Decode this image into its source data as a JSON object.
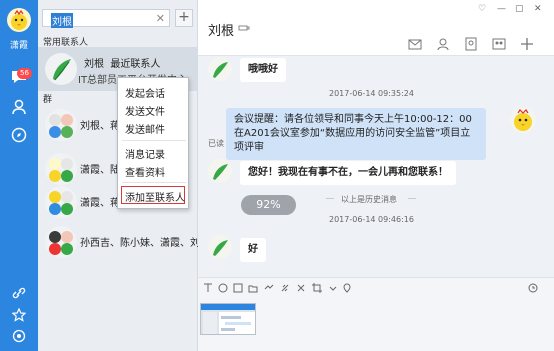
{
  "user": {
    "name": "潇霞",
    "unread": "56"
  },
  "search": {
    "value": "刘根"
  },
  "list": {
    "section_frequent": "常用联系人",
    "section_groups": "群",
    "frequent": [
      {
        "name": "刘根",
        "status": "最近联系人",
        "dept": "IT总部员工平台开发中心"
      }
    ],
    "groups": [
      {
        "members": "刘根、蒋伯"
      },
      {
        "members": "潇霞、陆涛"
      },
      {
        "members": "潇霞、蒋可"
      },
      {
        "members": "孙西吉、陈小妹、潇霞、刘根"
      }
    ]
  },
  "context_menu": {
    "items": [
      "发起会话",
      "发送文件",
      "发送邮件",
      "消息记录",
      "查看资料",
      "添加至联系人"
    ]
  },
  "chat": {
    "title": "刘根",
    "messages": [
      {
        "type": "in",
        "text": "哦哦好"
      },
      {
        "type": "time",
        "text": "2017-06-14 09:35:24"
      },
      {
        "type": "out",
        "text": "会议提醒：请各位领导和同事今天上午10:00-12：00 在A201会议室参加“数据应用的访问安全监管”项目立项评审",
        "read": "已读"
      },
      {
        "type": "in",
        "text": "您好！我现在有事不在，一会儿再和您联系！"
      },
      {
        "type": "history",
        "text": "以上是历史消息"
      },
      {
        "type": "time",
        "text": "2017-06-14 09:46:16"
      },
      {
        "type": "in",
        "text": "好"
      }
    ],
    "progress": "92%"
  },
  "colors": {
    "rail": "#2c86e0",
    "badge": "#ff4a4a",
    "bubble_out": "#cfe2f8",
    "highlight_border": "#d73a3a"
  }
}
